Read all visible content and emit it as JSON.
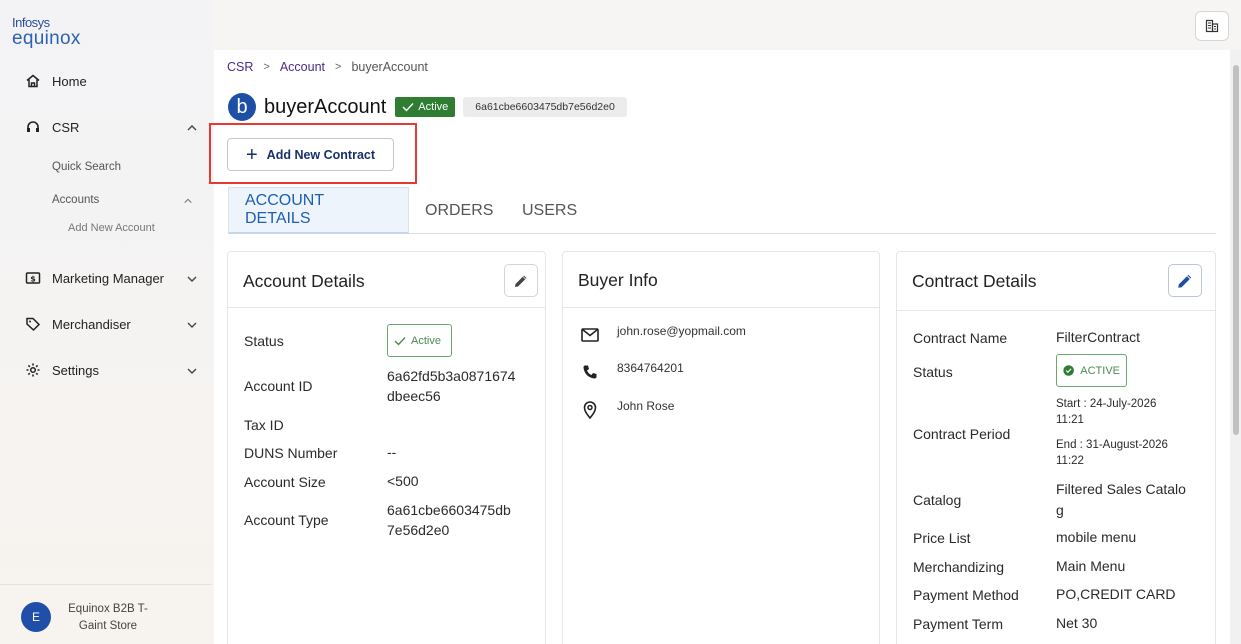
{
  "logo": {
    "line1": "Infosys",
    "line2": "equinox"
  },
  "sidebar": {
    "home": "Home",
    "csr": "CSR",
    "quick_search": "Quick Search",
    "accounts": "Accounts",
    "add_new_account": "Add New Account",
    "marketing_manager": "Marketing Manager",
    "merchandiser": "Merchandiser",
    "settings": "Settings",
    "user_initial": "E",
    "store_name": "Equinox B2B T-Gaint Store"
  },
  "breadcrumb": {
    "item1": "CSR",
    "item2": "Account",
    "item3": "buyerAccount"
  },
  "account": {
    "initial": "b",
    "name": "buyerAccount",
    "status": "Active",
    "id_chip": "6a61cbe6603475db7e56d2e0"
  },
  "actions": {
    "add_contract": "Add New Contract"
  },
  "tabs": {
    "account_details": "ACCOUNT DETAILS",
    "orders": "ORDERS",
    "users": "USERS"
  },
  "account_details": {
    "title": "Account Details",
    "status_label": "Status",
    "status_value": "Active",
    "account_id_label": "Account ID",
    "account_id_value_1": "6a62fd5b3a0871674",
    "account_id_value_2": "dbeec56",
    "tax_id_label": "Tax ID",
    "duns_label": "DUNS Number",
    "duns_value": "--",
    "size_label": "Account Size",
    "size_value": "<500",
    "type_label": "Account Type",
    "type_value_1": "6a61cbe6603475db",
    "type_value_2": "7e56d2e0"
  },
  "buyer_info": {
    "title": "Buyer Info",
    "email": "john.rose@yopmail.com",
    "phone": "8364764201",
    "name": "John Rose"
  },
  "contract_details": {
    "title": "Contract Details",
    "name_label": "Contract Name",
    "name_value": "FilterContract",
    "status_label": "Status",
    "status_value": "ACTIVE",
    "period_label": "Contract Period",
    "start_1": "Start : 24-July-2026",
    "start_2": "11:21",
    "end_1": "End : 31-August-2026",
    "end_2": "11:22",
    "catalog_label": "Catalog",
    "catalog_value_1": "Filtered Sales Catalo",
    "catalog_value_2": "g",
    "price_list_label": "Price List",
    "price_list_value": "mobile menu",
    "merch_label": "Merchandizing",
    "merch_value": "Main Menu",
    "payment_method_label": "Payment Method",
    "payment_method_value": "PO,CREDIT CARD",
    "payment_term_label": "Payment Term",
    "payment_term_value": "Net 30"
  },
  "icons": {
    "home": "home-icon",
    "csr": "headset-icon",
    "marketing": "dollar-box-icon",
    "merch": "tag-icon",
    "settings": "gear-icon",
    "building": "building-icon",
    "edit": "pencil-icon",
    "email": "mail-icon",
    "phone": "phone-icon",
    "location": "location-pin-icon"
  },
  "colors": {
    "brand": "#1d4fa6",
    "active_green": "#2e7d32",
    "highlight_red": "#e53935",
    "tab_active": "#1d5fb0"
  }
}
